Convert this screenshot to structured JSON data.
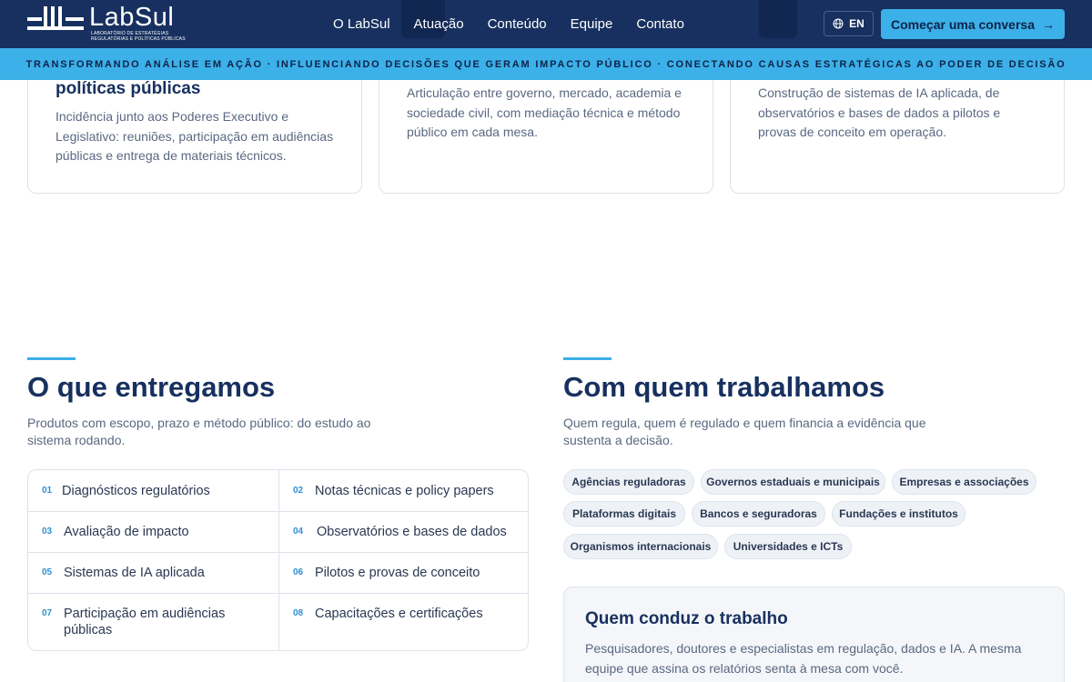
{
  "header": {
    "logo_text": "LabSul",
    "logo_subtitle_line1": "LABORATÓRIO DE ESTRATÉGIAS",
    "logo_subtitle_line2": "REGULATÓRIAS E POLÍTICAS PÚBLICAS",
    "nav": [
      "O LabSul",
      "Atuação",
      "Conteúdo",
      "Equipe",
      "Contato"
    ],
    "lang_label": "EN",
    "cta_label": "Começar uma conversa",
    "cta_arrow": "→"
  },
  "ticker": "TRANSFORMANDO ANÁLISE EM AÇÃO · INFLUENCIANDO DECISÕES QUE GERAM IMPACTO PÚBLICO · CONECTANDO CAUSAS ESTRATÉGICAS AO PODER DE DECISÃO",
  "cards": [
    {
      "title": "políticas públicas",
      "text": "Incidência junto aos Poderes Executivo e Legislativo: reuniões, participação em audiências públicas e entrega de materiais técnicos."
    },
    {
      "title": "",
      "text": "Articulação entre governo, mercado, academia e sociedade civil, com mediação técnica e método público em cada mesa."
    },
    {
      "title": "",
      "text": "Construção de sistemas de IA aplicada, de observatórios e bases de dados a pilotos e provas de conceito em operação."
    }
  ],
  "deliverables": {
    "title": "O que entregamos",
    "subtitle": "Produtos com escopo, prazo e método público: do estudo ao sistema rodando.",
    "items": [
      {
        "num": "01",
        "label": "Diagnósticos regulatórios"
      },
      {
        "num": "02",
        "label": "Notas técnicas e policy papers"
      },
      {
        "num": "03",
        "label": "Avaliação de impacto"
      },
      {
        "num": "04",
        "label": "Observatórios e bases de dados"
      },
      {
        "num": "05",
        "label": "Sistemas de IA aplicada"
      },
      {
        "num": "06",
        "label": "Pilotos e provas de conceito"
      },
      {
        "num": "07",
        "label": "Participação em audiências públicas"
      },
      {
        "num": "08",
        "label": "Capacitações e certificações"
      }
    ]
  },
  "partners": {
    "title": "Com quem trabalhamos",
    "subtitle": "Quem regula, quem é regulado e quem financia a evidência que sustenta a decisão.",
    "chips": [
      "Agências reguladoras",
      "Governos estaduais e municipais",
      "Empresas e associações",
      "Plataformas digitais",
      "Bancos e seguradoras",
      "Fundações e institutos",
      "Organismos internacionais",
      "Universidades e ICTs"
    ]
  },
  "team_panel": {
    "title": "Quem conduz o trabalho",
    "text": "Pesquisadores, doutores e especialistas em regulação, dados e IA. A mesma equipe que assina os relatórios senta à mesa com você."
  },
  "colors": {
    "navy": "#17305f",
    "accent": "#3cb0e8",
    "muted_text": "#5a6881",
    "border": "#dde3ec"
  }
}
